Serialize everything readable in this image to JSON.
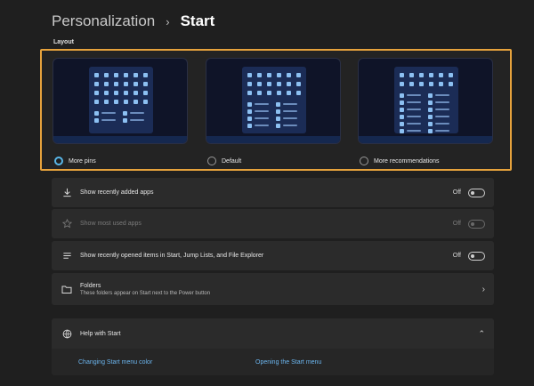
{
  "breadcrumb": {
    "parent": "Personalization",
    "separator": "›",
    "current": "Start"
  },
  "layout": {
    "label": "Layout",
    "options": [
      {
        "label": "More pins",
        "checked": true
      },
      {
        "label": "Default",
        "checked": false
      },
      {
        "label": "More recommendations",
        "checked": false
      }
    ],
    "highlight_color": "#e6a23c"
  },
  "settings": [
    {
      "label": "Show recently added apps",
      "state": "Off",
      "enabled": true,
      "icon": "download-icon"
    },
    {
      "label": "Show most used apps",
      "state": "Off",
      "enabled": false,
      "icon": "star-icon"
    },
    {
      "label": "Show recently opened items in Start, Jump Lists, and File Explorer",
      "state": "Off",
      "enabled": true,
      "icon": "list-icon"
    }
  ],
  "folders": {
    "title": "Folders",
    "subtitle": "These folders appear on Start next to the Power button",
    "icon": "folder-icon"
  },
  "help": {
    "title": "Help with Start",
    "icon": "globe-icon",
    "links": [
      "Changing Start menu color",
      "Opening the Start menu"
    ]
  },
  "colors": {
    "accent": "#58b6e8",
    "link": "#6cb6ef",
    "background": "#1f1f1f",
    "card": "#2b2b2b"
  }
}
